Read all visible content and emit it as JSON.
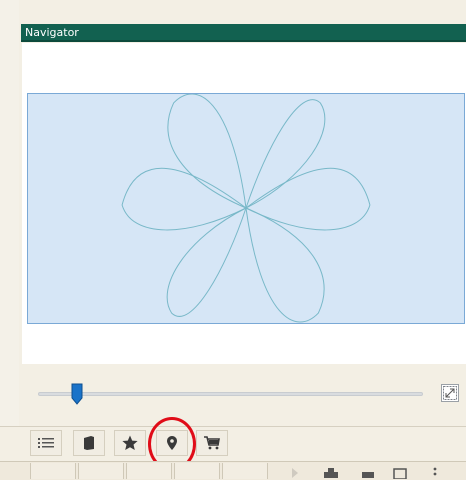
{
  "navigator": {
    "title": "Navigator"
  },
  "zoom": {
    "level_fraction": 0.1
  },
  "tabs": [
    {
      "name": "list-icon"
    },
    {
      "name": "book-icon"
    },
    {
      "name": "star-icon"
    },
    {
      "name": "location-pin-icon",
      "highlighted": true
    },
    {
      "name": "cart-icon"
    }
  ],
  "colors": {
    "titlebar": "#126150",
    "preview_fill": "#d6e6f6",
    "design_stroke": "#78b8c8",
    "slider_thumb": "#1a73c9",
    "highlight_circle": "#e00c18"
  }
}
